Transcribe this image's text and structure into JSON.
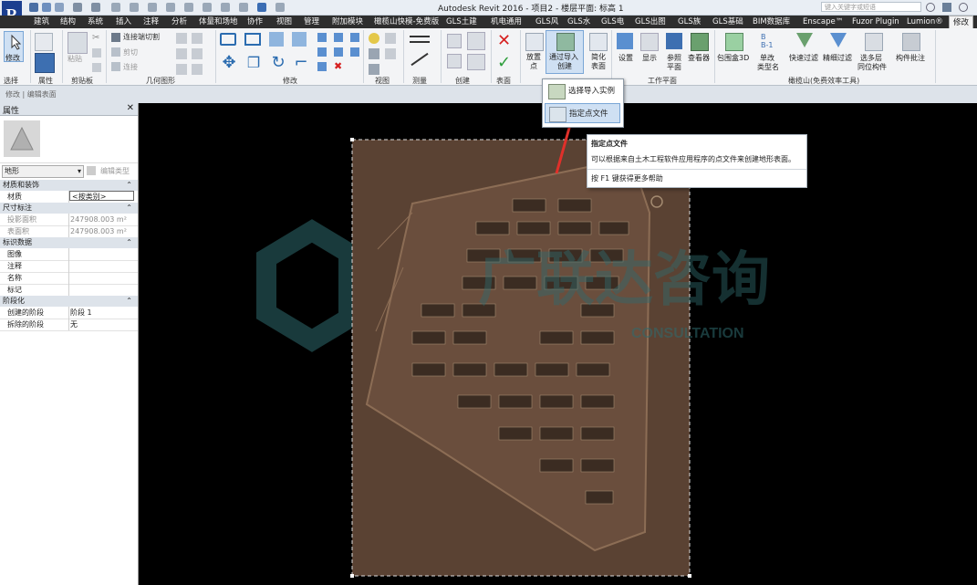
{
  "app": {
    "logo_letter": "R",
    "title": "Autodesk Revit 2016 -      项目2 - 楼层平面: 标高 1",
    "search_placeholder": "键入关键字或短语"
  },
  "tabs": [
    "建筑",
    "结构",
    "系统",
    "插入",
    "注释",
    "分析",
    "体量和场地",
    "协作",
    "视图",
    "管理",
    "附加模块",
    "橄榄山快模-免费版",
    "GLS土建",
    "机电通用",
    "GLS风",
    "GLS水",
    "GLS电",
    "GLS出图",
    "GLS族",
    "GLS基础",
    "BIM数据库",
    "Enscape™",
    "Fuzor Plugin",
    "Lumion®",
    "修改"
  ],
  "active_tab": "修改",
  "ribbon": {
    "groups": [
      "选择",
      "属性",
      "剪贴板",
      "几何图形",
      "修改",
      "视图",
      "测量",
      "创建",
      "表面",
      "工作平面",
      "橄榄山(免费效率工具)"
    ],
    "modify_btn": "修改",
    "paste_label": "粘贴",
    "join_label": "连接端切割",
    "cut_label": "剪切",
    "join2_label": "连接",
    "place_point": [
      "放置",
      "点"
    ],
    "import_create": [
      "通过导入",
      "创建"
    ],
    "simplify_surface": [
      "简化",
      "表面"
    ],
    "set_label": "设置",
    "show_label": "显示",
    "ref_plane": [
      "参照",
      "平面"
    ],
    "viewer_label": "查看器",
    "bbox3d_label": "包围盒3D",
    "single_change": [
      "单改",
      "类型名"
    ],
    "quick_filter": "快速过滤",
    "fine_filter": "精细过滤",
    "multi_select": [
      "选多层",
      "同位构件"
    ],
    "component_batch": "构件批注"
  },
  "options_bar": "修改 | 编辑表面",
  "dropdown": {
    "items": [
      "选择导入实例",
      "指定点文件"
    ]
  },
  "tooltip": {
    "title": "指定点文件",
    "desc": "可以根据来自土木工程软件应用程序的点文件来创建地形表面。",
    "help": "按 F1 键获得更多帮助"
  },
  "properties": {
    "header": "属性",
    "type_selector": "地形",
    "edit_type": "编辑类型",
    "sections": [
      {
        "name": "材质和装饰",
        "rows": [
          {
            "k": "材质",
            "v": "<按类别>",
            "editable": true
          }
        ]
      },
      {
        "name": "尺寸标注",
        "rows": [
          {
            "k": "投影面积",
            "v": "247908.003 m²",
            "editable": false
          },
          {
            "k": "表面积",
            "v": "247908.003 m²",
            "editable": false
          }
        ]
      },
      {
        "name": "标识数据",
        "rows": [
          {
            "k": "图像",
            "v": "",
            "editable": true
          },
          {
            "k": "注释",
            "v": "",
            "editable": true
          },
          {
            "k": "名称",
            "v": "",
            "editable": true
          },
          {
            "k": "标记",
            "v": "",
            "editable": true
          }
        ]
      },
      {
        "name": "阶段化",
        "rows": [
          {
            "k": "创建的阶段",
            "v": "阶段 1",
            "editable": true
          },
          {
            "k": "拆除的阶段",
            "v": "无",
            "editable": true
          }
        ]
      }
    ]
  },
  "watermark": {
    "text_cn": "广联达咨询",
    "text_en": "CONSULTATION"
  },
  "colors": {
    "tabbar": "#2e2e2e",
    "ribbon_bg": "#f3f4f6",
    "accent_blue": "#2b6cb0",
    "site_plan": "#5a4233",
    "arrow": "#e0302a",
    "cancel_red": "#d62020",
    "check_green": "#2e9e3c"
  }
}
